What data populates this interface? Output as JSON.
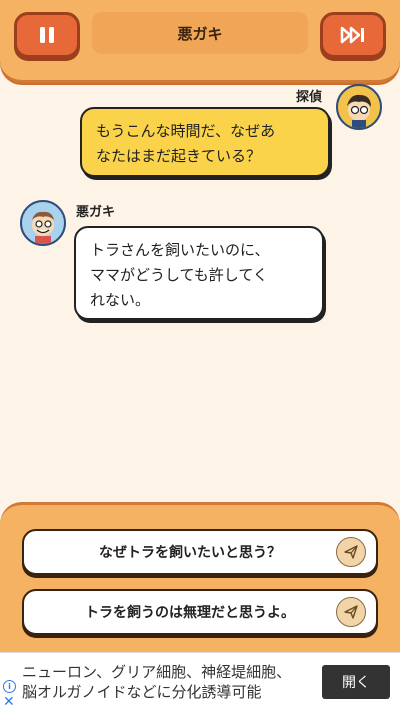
{
  "header": {
    "title": "悪ガキ",
    "pause_icon": "pause-icon",
    "skip_icon": "skip-icon"
  },
  "conversation": [
    {
      "speaker": "探偵",
      "text": "もうこんな時間だ、なぜあ\nなたはまだ起きている？"
    },
    {
      "speaker": "悪ガキ",
      "text": "トラさんを飼いたいのに、\nママがどうしても許してく\nれない。"
    }
  ],
  "choices": [
    {
      "label": "なぜトラを飼いたいと思う？",
      "icon": "send-icon"
    },
    {
      "label": "トラを飼うのは無理だと思うよ。",
      "icon": "send-icon"
    }
  ],
  "ad": {
    "text": "ニューロン、グリア細胞、神経堤細胞、\n脳オルガノイドなどに分化誘導可能",
    "button": "開く",
    "info_icon": "info-icon",
    "close_icon": "close-icon"
  },
  "colors": {
    "header_bg": "#f5b263",
    "button_orange": "#e7693a",
    "detective_bubble": "#fbd34b",
    "background": "#fdf3e6"
  }
}
